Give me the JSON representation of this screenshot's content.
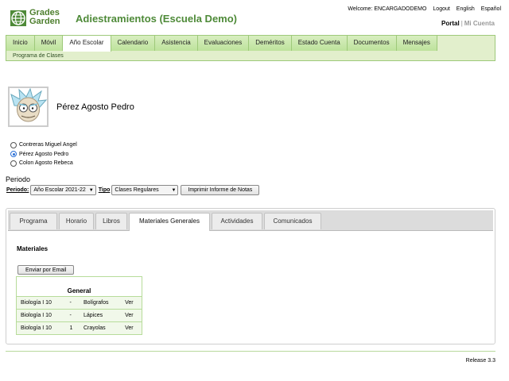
{
  "brand": {
    "logo_line1": "Grades",
    "logo_line2": "Garden"
  },
  "header": {
    "title": "Adiestramientos (Escuela Demo)"
  },
  "top_links": {
    "welcome": "Welcome: ENCARGADODEMO",
    "logout": "Logout",
    "english": "English",
    "espanol": "Español"
  },
  "portal_links": {
    "portal": "Portal",
    "separator": "|",
    "mi_cuenta": "Mi Cuenta"
  },
  "nav": {
    "tabs": [
      {
        "label": "Inicio"
      },
      {
        "label": "Móvil"
      },
      {
        "label": "Año Escolar",
        "active": true
      },
      {
        "label": "Calendario"
      },
      {
        "label": "Asistencia"
      },
      {
        "label": "Evaluaciones"
      },
      {
        "label": "Deméritos"
      },
      {
        "label": "Estado Cuenta"
      },
      {
        "label": "Documentos"
      },
      {
        "label": "Mensajes"
      }
    ],
    "sub_item": "Programa de Clases"
  },
  "student": {
    "name": "Pérez Agosto Pedro"
  },
  "student_list": [
    {
      "label": "Contreras Miguel Angel",
      "checked": false
    },
    {
      "label": "Pérez Agosto Pedro",
      "checked": true
    },
    {
      "label": "Colon Agosto Rebeca",
      "checked": false
    }
  ],
  "filters": {
    "heading": "Periodo",
    "periodo_label": "Periodo:",
    "periodo_value": "Año Escolar 2021-22",
    "tipo_label": "Tipo",
    "tipo_value": "Clases Regulares",
    "print_button": "Imprimir Informe de Notas"
  },
  "tabs": [
    {
      "label": "Programa"
    },
    {
      "label": "Horario"
    },
    {
      "label": "Libros"
    },
    {
      "label": "Materiales Generales",
      "active": true
    },
    {
      "label": "Actividades"
    },
    {
      "label": "Comunicados"
    }
  ],
  "materials": {
    "heading": "Materiales",
    "email_button": "Enviar por Email",
    "group_header": "General",
    "rows": [
      {
        "course": "Biología I 10",
        "qty": "-",
        "item": "Bolígrafos",
        "action": "Ver"
      },
      {
        "course": "Biología I 10",
        "qty": "-",
        "item": "Lápices",
        "action": "Ver"
      },
      {
        "course": "Biología I 10",
        "qty": "1",
        "item": "Crayolas",
        "action": "Ver"
      }
    ]
  },
  "footer": {
    "release": "Release 3.3"
  },
  "colors": {
    "brand_green": "#4e8a38",
    "nav_bg": "#e2efcc",
    "nav_border": "#9ec97a",
    "table_border": "#b7dc9a"
  }
}
